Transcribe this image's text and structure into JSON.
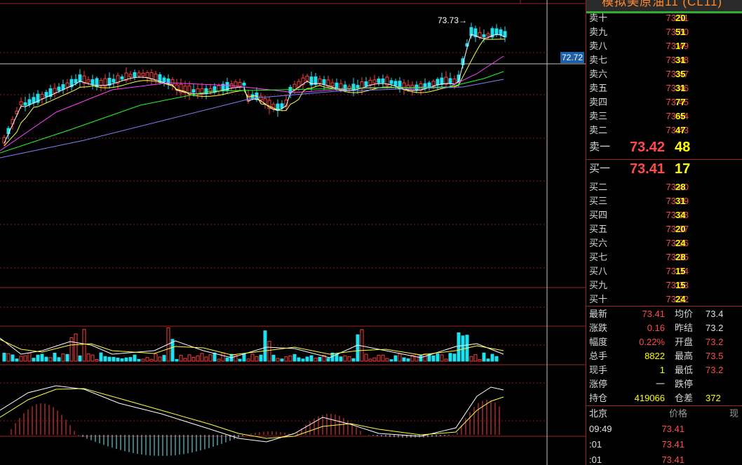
{
  "title": "模拟美原油11 (CL11)",
  "chart": {
    "price_tag": "72.72",
    "peak_label": "73.73→"
  },
  "sell_levels": [
    {
      "label": "卖十",
      "price": "73.51",
      "vol": "20"
    },
    {
      "label": "卖九",
      "price": "73.50",
      "vol": "51"
    },
    {
      "label": "卖八",
      "price": "73.49",
      "vol": "17"
    },
    {
      "label": "卖七",
      "price": "73.48",
      "vol": "31"
    },
    {
      "label": "卖六",
      "price": "73.47",
      "vol": "35"
    },
    {
      "label": "卖五",
      "price": "73.46",
      "vol": "31"
    },
    {
      "label": "卖四",
      "price": "73.45",
      "vol": "77"
    },
    {
      "label": "卖三",
      "price": "73.44",
      "vol": "65"
    },
    {
      "label": "卖二",
      "price": "73.43",
      "vol": "47"
    }
  ],
  "sell_one": {
    "label": "卖一",
    "price": "73.42",
    "vol": "48"
  },
  "buy_one": {
    "label": "买一",
    "price": "73.41",
    "vol": "17"
  },
  "buy_levels": [
    {
      "label": "买二",
      "price": "73.40",
      "vol": "28"
    },
    {
      "label": "买三",
      "price": "73.39",
      "vol": "31"
    },
    {
      "label": "买四",
      "price": "73.38",
      "vol": "34"
    },
    {
      "label": "买五",
      "price": "73.37",
      "vol": "20"
    },
    {
      "label": "买六",
      "price": "73.36",
      "vol": "24"
    },
    {
      "label": "买七",
      "price": "73.35",
      "vol": "28"
    },
    {
      "label": "买八",
      "price": "73.34",
      "vol": "15"
    },
    {
      "label": "买九",
      "price": "73.33",
      "vol": "15"
    },
    {
      "label": "买十",
      "price": "73.32",
      "vol": "24"
    }
  ],
  "quote": [
    {
      "l1": "最新",
      "v1": "73.41",
      "c1": "red",
      "l2": "均价",
      "v2": "73.4",
      "c2": "wht"
    },
    {
      "l1": "涨跌",
      "v1": "0.16",
      "c1": "red",
      "l2": "昨结",
      "v2": "73.2",
      "c2": "wht"
    },
    {
      "l1": "幅度",
      "v1": "0.22%",
      "c1": "red",
      "l2": "开盘",
      "v2": "73.2",
      "c2": "red"
    },
    {
      "l1": "总手",
      "v1": "8822",
      "c1": "yel",
      "l2": "最高",
      "v2": "73.5",
      "c2": "red"
    },
    {
      "l1": "现手",
      "v1": "1",
      "c1": "yel",
      "l2": "最低",
      "v2": "73.2",
      "c2": "red"
    },
    {
      "l1": "涨停",
      "v1": "一",
      "c1": "wht",
      "l2": "跌停",
      "v2": "",
      "c2": "wht"
    },
    {
      "l1": "持仓",
      "v1": "419066",
      "c1": "yel",
      "l2": "仓差",
      "v2": "372",
      "c2": "yel"
    }
  ],
  "ticks_header": {
    "time": "北京",
    "price": "价格",
    "vol": "现"
  },
  "ticks": [
    {
      "time": "09:49",
      "price": "73.41"
    },
    {
      "time": ":01",
      "price": "73.41"
    },
    {
      "time": ":01",
      "price": "73.41"
    }
  ]
}
